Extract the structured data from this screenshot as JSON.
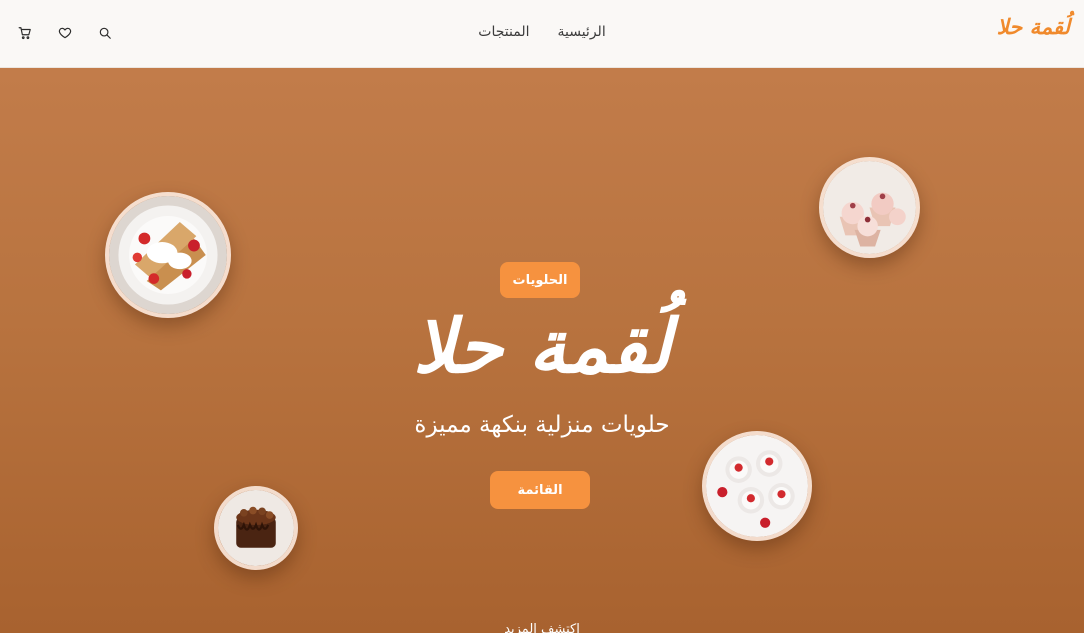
{
  "header": {
    "logo_text": "لُقمة حلا",
    "nav": [
      {
        "label": "الرئيسية"
      },
      {
        "label": "المنتجات"
      }
    ],
    "icons": [
      "search-icon",
      "heart-icon",
      "cart-icon"
    ]
  },
  "hero": {
    "badge": "الحلويات",
    "title": "لُقمة حلا",
    "subtitle": "حلويات منزلية بنكهة مميزة",
    "button": "القائمة",
    "discover": "اكتشف المزيد"
  },
  "colors": {
    "accent": "#f6923f",
    "logo": "#f08a2c",
    "hero_top": "#c27c4a",
    "hero_bottom": "#a8622f"
  },
  "images": [
    {
      "name": "crepes-plate-image"
    },
    {
      "name": "cupcakes-image"
    },
    {
      "name": "strawberry-cups-image"
    },
    {
      "name": "chocolate-cake-image"
    }
  ]
}
